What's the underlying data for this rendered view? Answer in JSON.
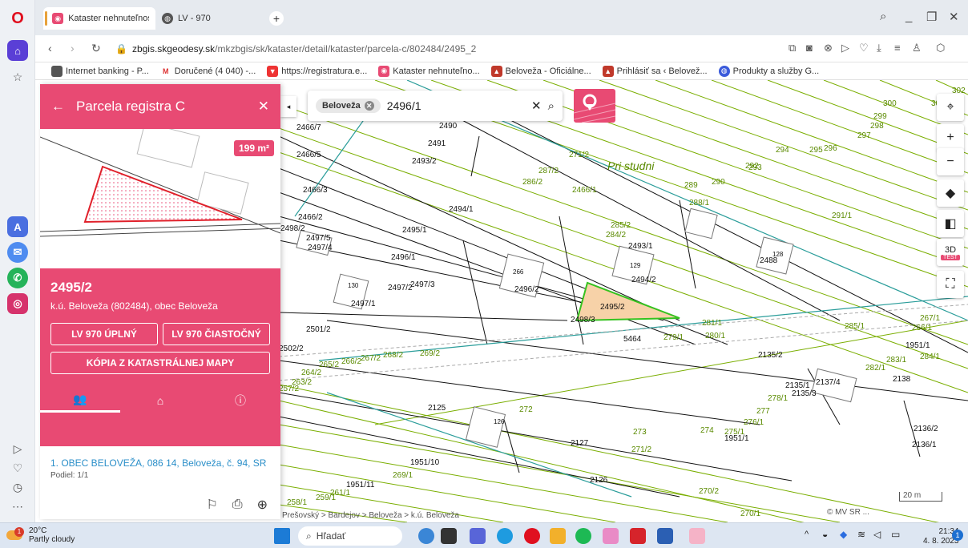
{
  "browser": {
    "tabs": [
      {
        "title": "Kataster nehnuteľností | Z"
      },
      {
        "title": "LV - 970"
      }
    ],
    "url_host": "zbgis.skgeodesy.sk",
    "url_path": "/mkzbgis/sk/kataster/detail/kataster/parcela-c/802484/2495_2",
    "bookmarks": [
      "Internet banking - P...",
      "Doručené (4 040) -...",
      "https://registratura.e...",
      "Kataster nehnuteľno...",
      "Beloveža - Oficiálne...",
      "Prihlásiť sa ‹ Belovež...",
      "Produkty a služby G..."
    ]
  },
  "search": {
    "chip": "Beloveža",
    "value": "2496/1"
  },
  "panel": {
    "title": "Parcela registra C",
    "area": "199 m²",
    "parcel_number": "2495/2",
    "cadastral_area": "k.ú. Beloveža (802484), obec Beloveža",
    "btn_full": "LV 970 ÚPLNÝ",
    "btn_partial": "LV 970 ČIASTOČNÝ",
    "btn_copy": "KÓPIA Z KATASTRÁLNEJ MAPY",
    "owner": "1. OBEC BELOVEŽA, 086 14, Beloveža, č. 94, SR",
    "share": "Podiel: 1/1"
  },
  "map": {
    "region_label": "Pri studni",
    "breadcrumbs": "Prešovský > Bardejov > Beloveža > k.ú. Beloveža",
    "copyright": "© MV SR ...",
    "scale": "20 m",
    "mode_3d": "3D",
    "test_badge": "TEST",
    "parcel_labels": [
      "2490",
      "2491",
      "2493/2",
      "2466/7",
      "2466/5",
      "2466/3",
      "2466/2",
      "2494/1",
      "2495/1",
      "2496/1",
      "2497/5",
      "2497/4",
      "2498/2",
      "2493/1",
      "2494/2",
      "2496/2",
      "2495/2",
      "2497/1",
      "2497/2",
      "2497/3",
      "2498/3",
      "2501/2",
      "2502/2",
      "5464",
      "2135/2",
      "2135/1",
      "2135/3",
      "2137/4",
      "2138",
      "2125",
      "2127",
      "1951/10",
      "1951/11",
      "2126",
      "2136/2",
      "2136/1",
      "2488",
      "1951/1",
      "1951/1"
    ],
    "green_labels": [
      "302",
      "301",
      "300",
      "299",
      "298",
      "297",
      "296",
      "295",
      "294",
      "293",
      "292",
      "291/1",
      "290",
      "289",
      "288/1",
      "287/2",
      "286/2",
      "285/2",
      "284/2",
      "281/1",
      "280/1",
      "279/1",
      "285/1",
      "267/1",
      "266/1",
      "283/1",
      "284/1",
      "282/1",
      "278/1",
      "277",
      "276/1",
      "275/1",
      "274",
      "273",
      "272",
      "271/2",
      "270/2",
      "270/1",
      "269/1",
      "261/1",
      "259/1",
      "258/1",
      "257/2",
      "263/2",
      "264/2",
      "265/2",
      "266/2",
      "267/2",
      "268/2",
      "269/2",
      "271/2",
      "2466/1",
      "2489"
    ],
    "building_numbers": [
      "266",
      "129",
      "128",
      "130",
      "126"
    ]
  },
  "taskbar": {
    "temp": "20°C",
    "weather": "Partly cloudy",
    "search": "Hľadať",
    "time": "21:34",
    "date": "4. 8. 2023",
    "notif": "1",
    "weather_badge": "1"
  },
  "colors": {
    "brand": "#e84a73",
    "parcel_fill": "#f7d2a8",
    "parcel_outline": "#35c21f",
    "line_green": "#7aae00",
    "line_teal": "#2a9d9a"
  }
}
